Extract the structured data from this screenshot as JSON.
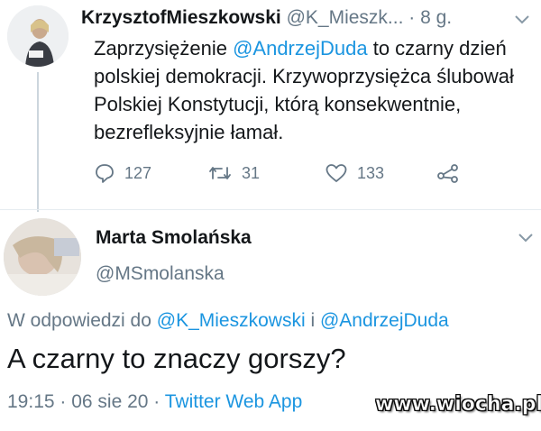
{
  "first_tweet": {
    "author_name": "KrzysztofMieszkowski",
    "handle": "@K_Mieszk...",
    "time": "· 8 g.",
    "text_plain_1": "Zaprzysiężenie ",
    "mention": "@AndrzejDuda",
    "text_plain_2": "  to czarny dzień  polskiej demokracji. Krzywoprzysiężca ślubował Polskiej Konstytucji, którą konsekwentnie, bezrefleksyjnie łamał.",
    "reply_count": "127",
    "retweet_count": "31",
    "like_count": "133"
  },
  "reply_tweet": {
    "author_name": "Marta Smolańska",
    "handle": "@MSmolanska",
    "replying_prefix": "W odpowiedzi do ",
    "replying_user_1": "@K_Mieszkowski",
    "replying_sep": " i ",
    "replying_user_2": "@AndrzejDuda",
    "text": "A czarny to znaczy gorszy?",
    "timestamp": "19:15 · 06 sie 20 · ",
    "source": "Twitter Web App"
  },
  "watermark": "www.wiocha.pl",
  "colors": {
    "link": "#1b95e0",
    "muted": "#657786",
    "divider": "#e6ecf0"
  }
}
